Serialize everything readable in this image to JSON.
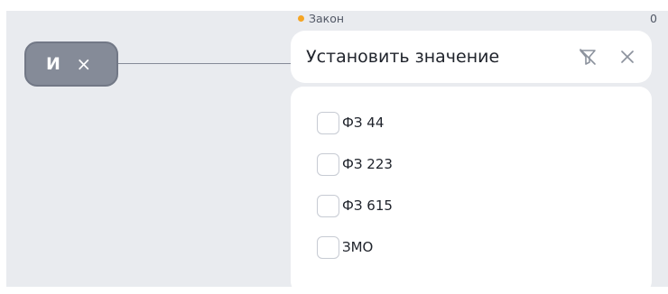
{
  "logic_chip": {
    "label": "И",
    "close_glyph": "×"
  },
  "field": {
    "title": "Закон",
    "count": "0",
    "accent_color": "#f5a524",
    "input_text": "Установить значение",
    "filter_icon": "filter-off-icon",
    "close_icon": "close-icon"
  },
  "options": [
    {
      "label": "ФЗ 44",
      "checked": false
    },
    {
      "label": "ФЗ 223",
      "checked": false
    },
    {
      "label": "ФЗ 615",
      "checked": false
    },
    {
      "label": "ЗМО",
      "checked": false
    }
  ]
}
